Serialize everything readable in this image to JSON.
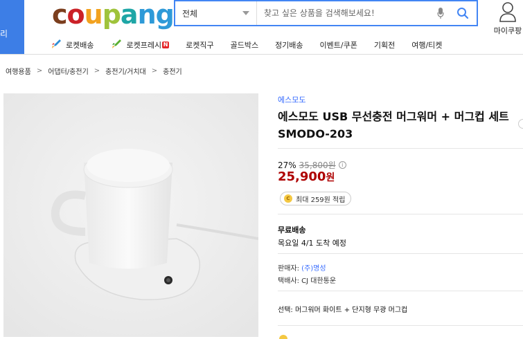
{
  "header": {
    "category_label": "리",
    "logo_letters": [
      {
        "ch": "c",
        "color": "#7b3e1e"
      },
      {
        "ch": "o",
        "color": "#cb2127"
      },
      {
        "ch": "u",
        "color": "#f2a21f"
      },
      {
        "ch": "p",
        "color": "#9fc33b"
      },
      {
        "ch": "a",
        "color": "#1ea6a6"
      },
      {
        "ch": "n",
        "color": "#2e9ad8"
      },
      {
        "ch": "g",
        "color": "#2e9ad8"
      }
    ],
    "search_category": "전체",
    "search_placeholder": "찾고 싶은 상품을 검색해보세요!",
    "mycoupang_label": "마이쿠팡"
  },
  "gnb": {
    "items": [
      {
        "label": "로켓배송",
        "icon": "rocket-icon"
      },
      {
        "label": "로켓프레시",
        "icon": "rocket-fresh-icon",
        "badge": "N"
      },
      {
        "label": "로켓직구"
      },
      {
        "label": "골드박스"
      },
      {
        "label": "정기배송"
      },
      {
        "label": "이벤트/쿠폰"
      },
      {
        "label": "기획전"
      },
      {
        "label": "여행/티켓"
      }
    ]
  },
  "breadcrumb": [
    "여행용품",
    "어댑터/충전기",
    "충전기/거치대",
    "충전기"
  ],
  "product": {
    "brand": "에스모도",
    "title": "에스모도 USB 무선충전 머그워머 + 머그컵 세트 SMODO-203",
    "discount_rate": "27%",
    "original_price": "35,800원",
    "price_number": "25,900",
    "price_unit": "원",
    "reward": "최대 259원 적립",
    "reward_coin": "C",
    "shipping_title": "무료배송",
    "shipping_date": "목요일 4/1 도착 예정",
    "seller_label": "판매자:",
    "seller_name": "(주)명성",
    "courier": "택배사: CJ 대한통운",
    "option": "선택: 머그워머 화이트 + 단지형 무광 머그컵"
  },
  "colors": {
    "accent_blue": "#346aff",
    "price_red": "#ae0000",
    "search_border": "#4285f4",
    "category_tab": "#3d7ee6"
  }
}
